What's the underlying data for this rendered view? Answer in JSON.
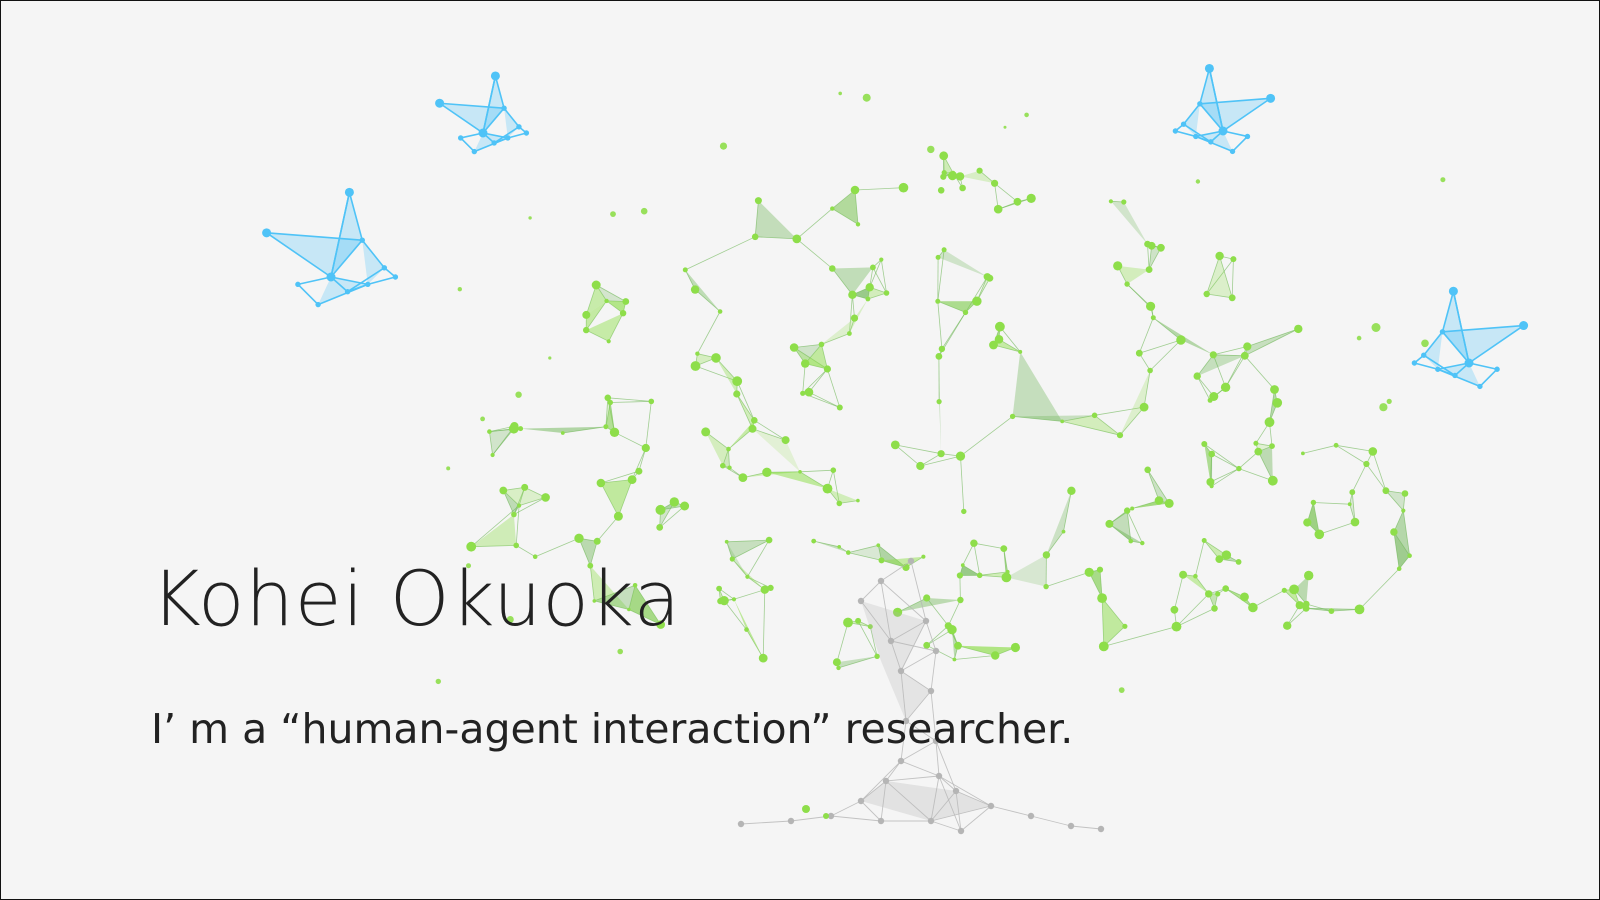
{
  "hero": {
    "name": "Kohei Okuoka",
    "tagline": "I’ m a “human-agent interaction” researcher."
  },
  "illustration": {
    "icons": [
      "network-tree-icon",
      "paper-crane-icon"
    ],
    "colors": {
      "background": "#f5f5f5",
      "leaf_green": "#8ede4a",
      "leaf_dark": "#73b85c",
      "trunk_gray": "#b5b5b5",
      "crane_blue": "#4fc3f7",
      "text": "#222222"
    }
  }
}
